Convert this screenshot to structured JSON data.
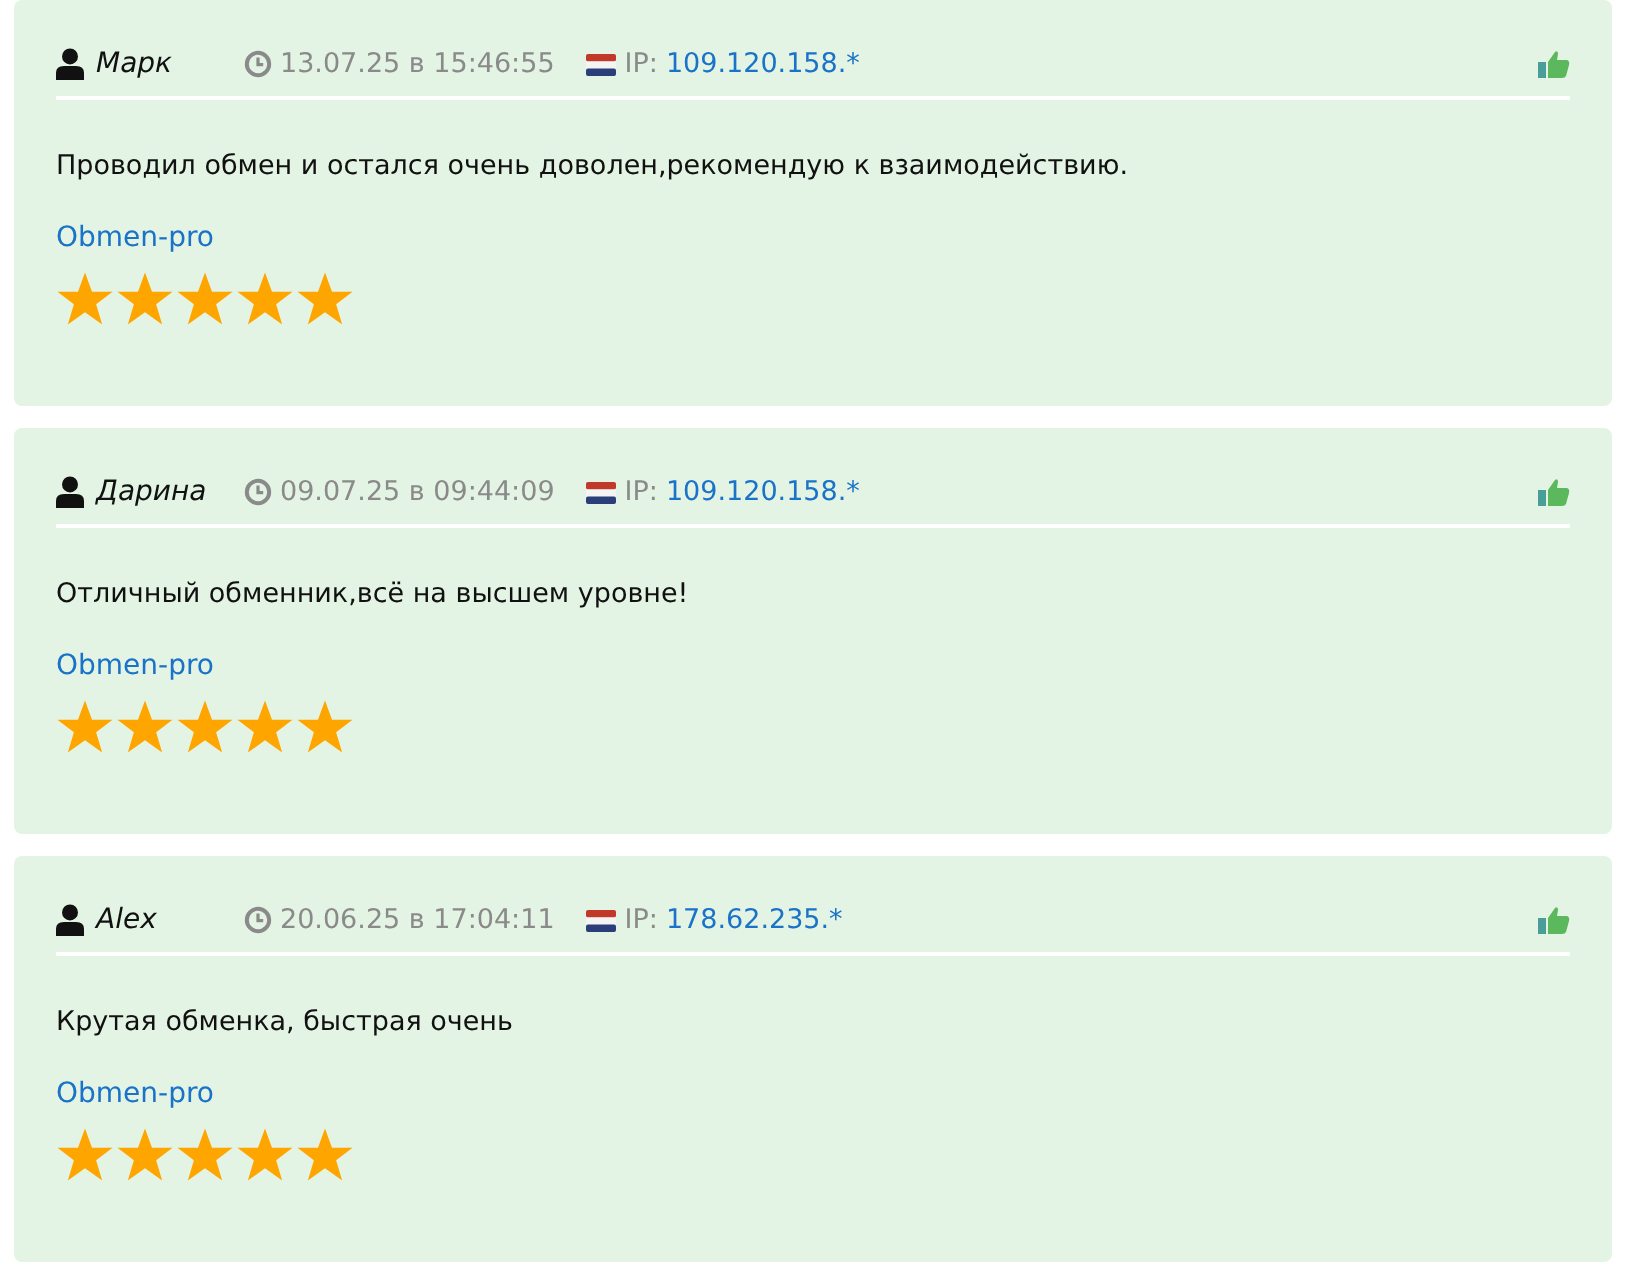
{
  "reviews": [
    {
      "author": "Марк",
      "date": "13.07.25 в 15:46:55",
      "ip_label": "IP:",
      "ip": "109.120.158.*",
      "text": "Проводил обмен и остался очень доволен,рекомендую к взаимодействию.",
      "site": "Obmen-pro",
      "stars": 5
    },
    {
      "author": "Дарина",
      "date": "09.07.25 в 09:44:09",
      "ip_label": "IP:",
      "ip": "109.120.158.*",
      "text": "Отличный обменник,всё на высшем уровне!",
      "site": "Obmen-pro",
      "stars": 5
    },
    {
      "author": "Alex",
      "date": "20.06.25 в 17:04:11",
      "ip_label": "IP:",
      "ip": "178.62.235.*",
      "text": "Крутая обменка, быстрая очень",
      "site": "Obmen-pro",
      "stars": 5
    }
  ]
}
